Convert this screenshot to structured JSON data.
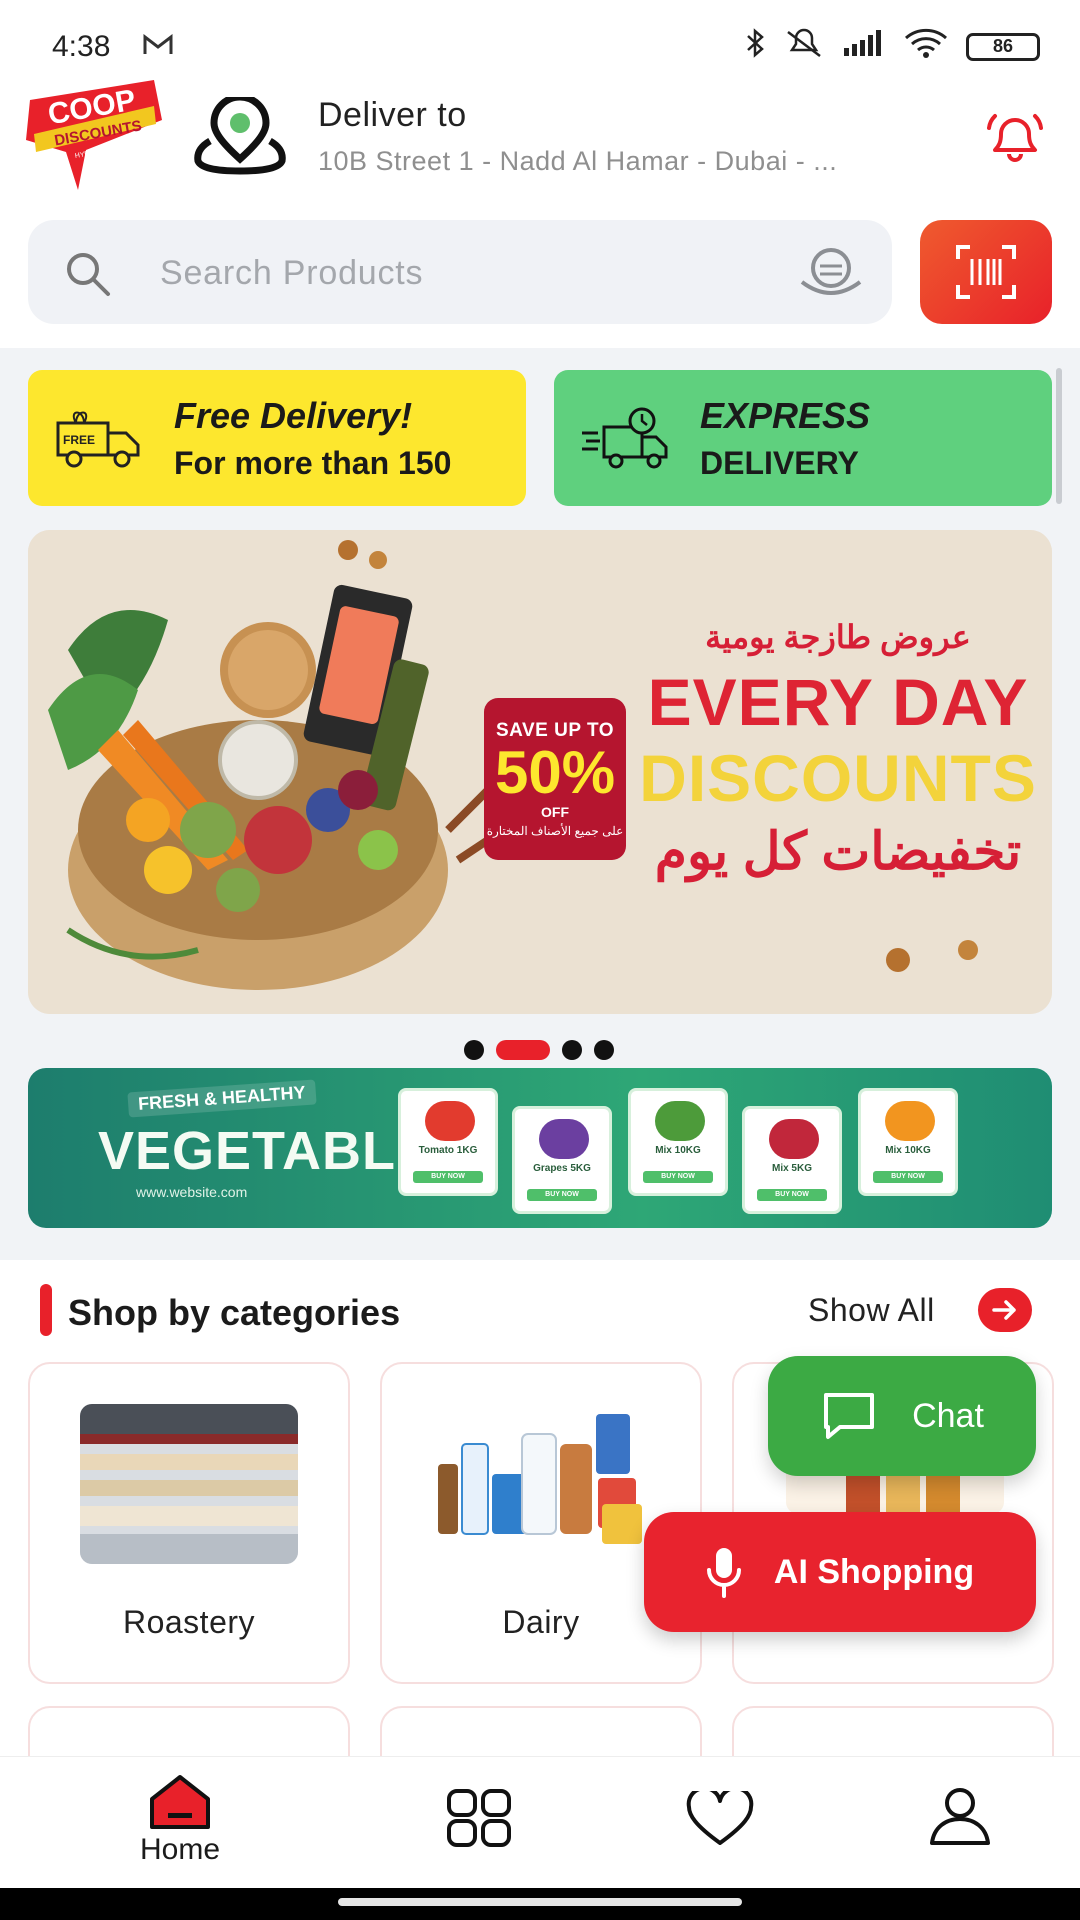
{
  "status_bar": {
    "time": "4:38",
    "battery": "86"
  },
  "header": {
    "logo_text": "COOP DISCOUNTS",
    "logo_sub": "HYPER MARKET",
    "deliver_label": "Deliver to",
    "address": "10B Street 1 - Nadd Al Hamar - Dubai - ..."
  },
  "search": {
    "placeholder": "Search Products"
  },
  "promos": {
    "free_delivery_title": "Free Delivery!",
    "free_delivery_sub": "For more than 150",
    "free_icon_text": "FREE",
    "express_title": "EXPRESS",
    "express_sub": "DELIVERY"
  },
  "hero": {
    "badge_top": "SAVE UP TO",
    "badge_percent": "50%",
    "badge_off": "OFF",
    "badge_arabic": "على جميع الأصناف المختارة",
    "arabic_top": "عروض طازجة يومية",
    "title_line1": "EVERY DAY",
    "title_line2": "DISCOUNTS",
    "arabic_bottom": "تخفيضات كل يوم"
  },
  "carousel": {
    "active_index": 1,
    "count": 4
  },
  "veg_banner": {
    "tag": "FRESH & HEALTHY",
    "title": "VEGETABLE",
    "website": "www.website.com",
    "cards": [
      {
        "label": "Tomato 1KG",
        "color": "#e23b2e"
      },
      {
        "label": "Grapes 5KG",
        "color": "#6b3fa0"
      },
      {
        "label": "Mix 10KG",
        "color": "#4d9b3a"
      },
      {
        "label": "Mix 5KG",
        "color": "#c1273b"
      },
      {
        "label": "Mix 10KG",
        "color": "#f2951f"
      }
    ],
    "buy_label": "BUY NOW"
  },
  "categories": {
    "title": "Shop by categories",
    "show_all": "Show All",
    "items": [
      {
        "label": "Roastery"
      },
      {
        "label": "Dairy"
      },
      {
        "label": ""
      }
    ]
  },
  "floating": {
    "chat_label": "Chat",
    "ai_label": "AI Shopping"
  },
  "bottom_nav": {
    "home_label": "Home"
  },
  "colors": {
    "accent": "#e8212a",
    "yellow": "#fde72e",
    "green": "#5fd07e",
    "chat_green": "#3caa44"
  }
}
